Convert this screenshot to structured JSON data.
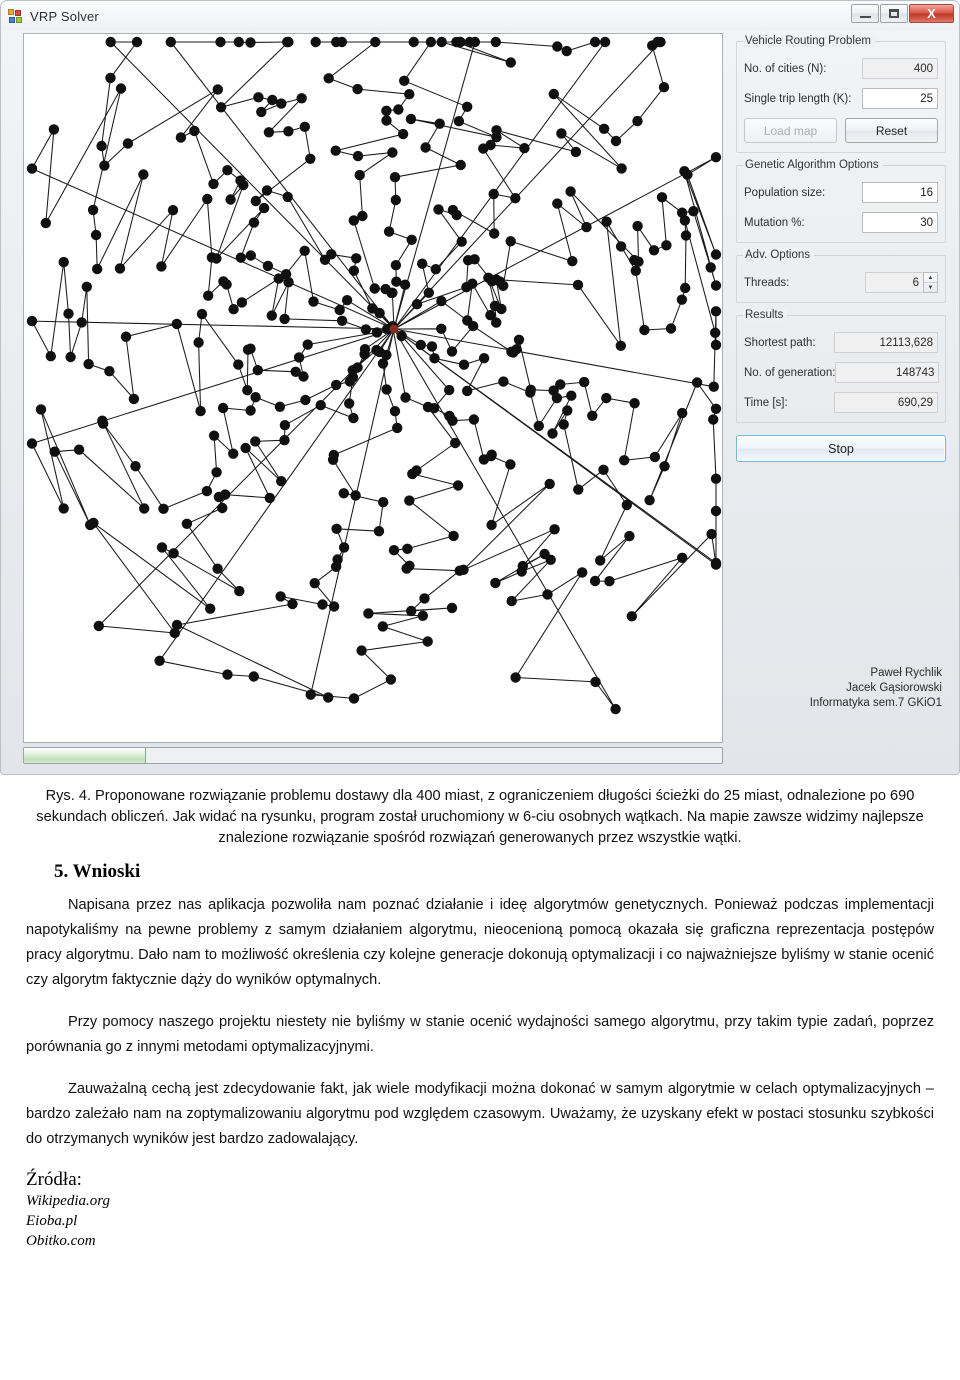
{
  "window": {
    "title": "VRP Solver",
    "icon": "app-icon",
    "controls": {
      "minimize": "–",
      "maximize": "□",
      "close": "X"
    }
  },
  "map": {
    "name": "vrp-route-map",
    "cities_count": 400,
    "depot_color": "#8b2b1d",
    "node_color": "#101010",
    "edge_color": "#1a1a1a",
    "background": "#ffffff"
  },
  "progress": {
    "percent": 17.5,
    "color": "#bfe0b8"
  },
  "panel": {
    "vrp_group": {
      "title": "Vehicle Routing Problem",
      "fields": [
        {
          "label": "No. of cities (N):",
          "value": "400",
          "readonly": true
        },
        {
          "label": "Single trip length (K):",
          "value": "25",
          "readonly": false
        }
      ],
      "buttons": [
        {
          "label": "Load map",
          "disabled": true
        },
        {
          "label": "Reset",
          "disabled": false
        }
      ]
    },
    "ga_group": {
      "title": "Genetic Algorithm Options",
      "fields": [
        {
          "label": "Population size:",
          "value": "16"
        },
        {
          "label": "Mutation %:",
          "value": "30"
        }
      ]
    },
    "adv_group": {
      "title": "Adv. Options",
      "fields": [
        {
          "label": "Threads:",
          "value": "6"
        }
      ],
      "spinner_up": "▲",
      "spinner_down": "▼"
    },
    "results_group": {
      "title": "Results",
      "fields": [
        {
          "label": "Shortest path:",
          "value": "12113,628"
        },
        {
          "label": "No. of generation:",
          "value": "148743"
        },
        {
          "label": "Time [s]:",
          "value": "690,29"
        }
      ]
    },
    "stop_button": "Stop",
    "credits": [
      "Paweł Rychlik",
      "Jacek Gąsiorowski",
      "Informatyka sem.7 GKiO1"
    ]
  },
  "document": {
    "caption": "Rys. 4. Proponowane rozwiązanie problemu dostawy dla 400 miast, z ograniczeniem długości ścieżki do 25 miast, odnalezione po 690 sekundach obliczeń. Jak widać na rysunku, program został uruchomiony w 6-ciu osobnych wątkach. Na mapie zawsze widzimy najlepsze znalezione rozwiązanie spośród rozwiązań generowanych przez wszystkie wątki.",
    "section_heading": "5. Wnioski",
    "paragraphs": [
      "Napisana przez nas aplikacja pozwoliła nam poznać działanie i ideę algorytmów genetycznych. Ponieważ podczas implementacji napotykaliśmy na pewne problemy z samym działaniem algorytmu, nieocenioną pomocą okazała się graficzna reprezentacja postępów pracy algorytmu. Dało nam to możliwość określenia czy kolejne generacje dokonują optymalizacji i co najważniejsze byliśmy w stanie ocenić czy algorytm faktycznie dąży do wyników optymalnych.",
      "Przy pomocy naszego projektu niestety nie byliśmy w stanie ocenić wydajności samego algorytmu, przy takim typie zadań, poprzez porównania go z innymi metodami optymalizacyjnymi.",
      "Zauważalną cechą jest zdecydowanie fakt, jak wiele modyfikacji można dokonać w samym algorytmie w celach optymalizacyjnych – bardzo zależało nam na zoptymalizowaniu algorytmu pod względem czasowym. Uważamy, że uzyskany efekt w postaci stosunku szybkości do otrzymanych wyników jest bardzo zadowalający."
    ],
    "sources_heading": "Źródła:",
    "sources": [
      "Wikipedia.org",
      "Eioba.pl",
      "Obitko.com"
    ]
  }
}
